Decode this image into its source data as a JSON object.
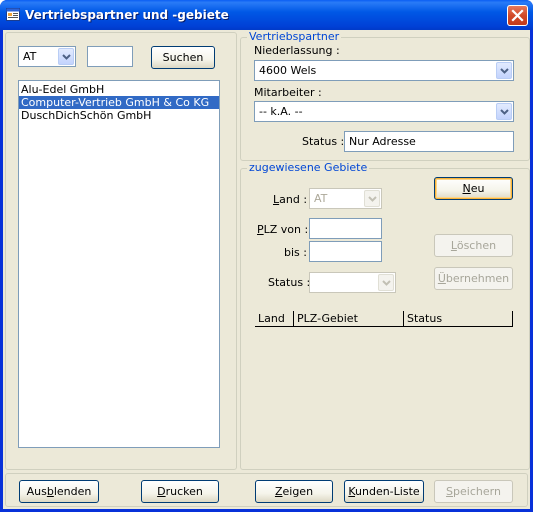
{
  "window": {
    "title": "Vertriebspartner und -gebiete"
  },
  "search": {
    "country_value": "AT",
    "text_value": "",
    "search_button": "Suchen"
  },
  "partner_list": {
    "items": [
      {
        "label": "Alu-Edel GmbH",
        "selected": false
      },
      {
        "label": "Computer-Vertrieb GmbH & Co KG",
        "selected": true
      },
      {
        "label": "DuschDichSchön GmbH",
        "selected": false
      }
    ]
  },
  "vertriebspartner": {
    "group_title": "Vertriebspartner",
    "niederlassung_label": "Niederlassung :",
    "niederlassung_value": "4600 Wels",
    "mitarbeiter_label": "Mitarbeiter :",
    "mitarbeiter_value": "-- k.A. --",
    "status_label": "Status :",
    "status_value": "Nur Adresse"
  },
  "gebiete": {
    "group_title": "zugewiesene Gebiete",
    "land_label": "Land :",
    "land_value": "AT",
    "plz_von_label": "PLZ von :",
    "plz_von_value": "",
    "bis_label": "bis :",
    "bis_value": "",
    "status_label": "Status :",
    "status_value": "",
    "neu_button": "Neu",
    "loeschen_button": "Löschen",
    "uebernehmen_button": "Übernehmen",
    "columns": [
      "Land",
      "PLZ-Gebiet",
      "Status"
    ]
  },
  "footer": {
    "ausblenden": "Ausblenden",
    "drucken": "Drucken",
    "zeigen": "Zeigen",
    "kunden_liste": "Kunden-Liste",
    "speichern": "Speichern"
  },
  "colors": {
    "titlebar": "#0058e6",
    "face": "#ece9d8",
    "selection": "#316ac5",
    "group_title": "#0046d5"
  }
}
